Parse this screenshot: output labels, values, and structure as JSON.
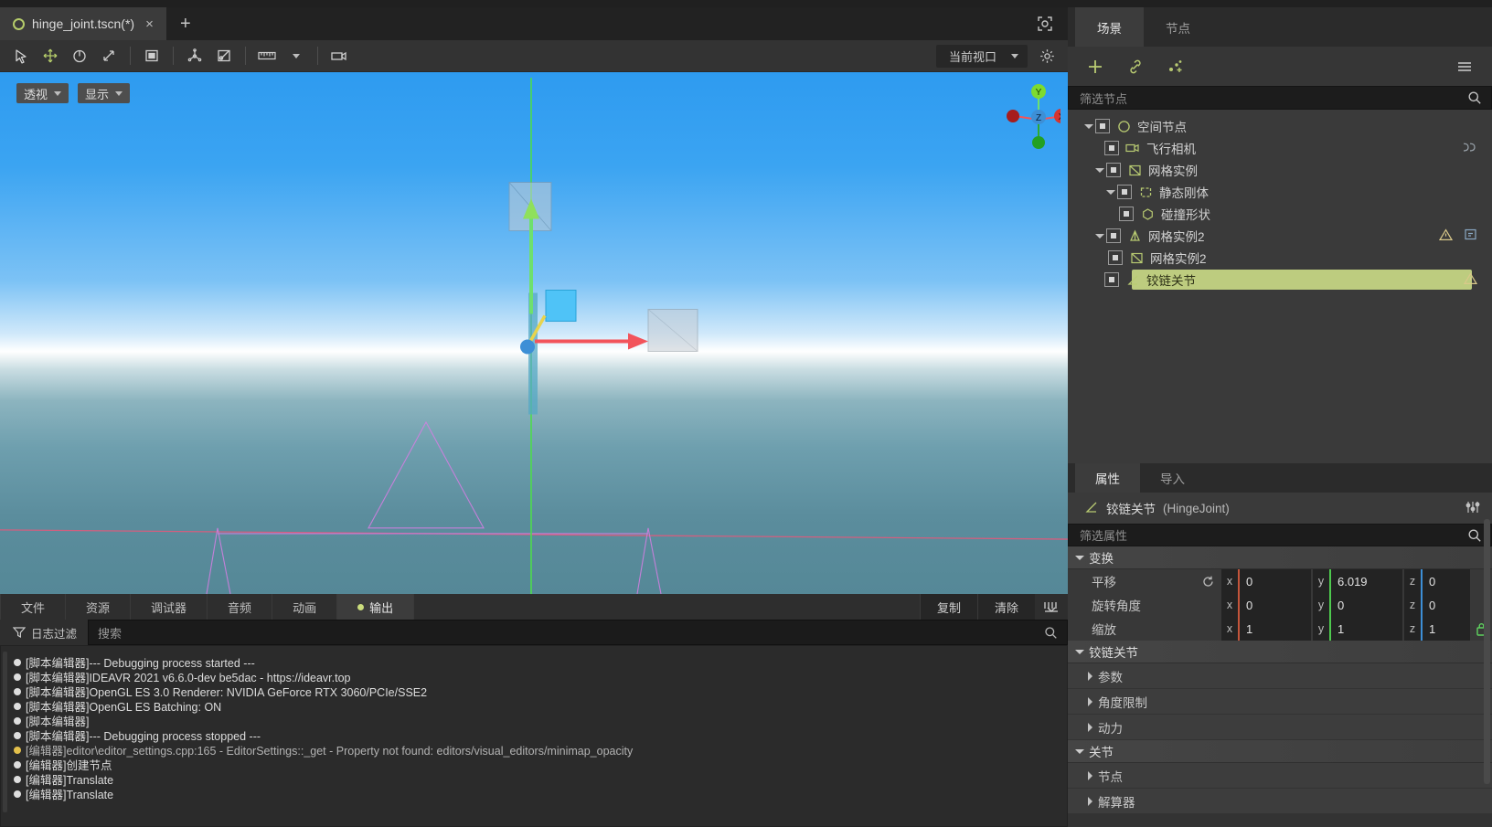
{
  "window": {
    "title": "hinge_joint.tscn(*)"
  },
  "tabbar": {
    "scene_tab_label": "hinge_joint.tscn(*)",
    "close_label": "×",
    "new_tab_label": "+",
    "distraction_free_icon": "expand-icon"
  },
  "toolbar": {
    "tools": [
      {
        "name": "select-mode",
        "icon": "cursor-arrow-icon",
        "selected": false
      },
      {
        "name": "move-mode",
        "icon": "move-arrows-icon",
        "selected": false
      },
      {
        "name": "rotate-mode",
        "icon": "rotate-icon",
        "selected": false
      },
      {
        "name": "scale-mode",
        "icon": "scale-icon",
        "selected": false
      },
      {
        "name": "list-select-mode",
        "icon": "box-select-icon",
        "selected": false
      },
      {
        "name": "local-space-mode",
        "icon": "axis-icon",
        "selected": false
      },
      {
        "name": "snap-mode",
        "icon": "snap-icon",
        "selected": false
      },
      {
        "name": "ruler-mode",
        "icon": "ruler-icon",
        "selected": false
      },
      {
        "name": "camera-preview",
        "icon": "camera-icon",
        "selected": false
      }
    ],
    "viewport_select_label": "当前视口",
    "settings_icon": "gear-icon"
  },
  "viewport": {
    "perspective_label": "透视",
    "display_label": "显示",
    "gizmo_axes": [
      "Y",
      "Z",
      "X"
    ]
  },
  "bottom_dock": {
    "tabs": [
      {
        "label": "文件",
        "active": false,
        "dot": false
      },
      {
        "label": "资源",
        "active": false,
        "dot": false
      },
      {
        "label": "调试器",
        "active": false,
        "dot": false
      },
      {
        "label": "音频",
        "active": false,
        "dot": false
      },
      {
        "label": "动画",
        "active": false,
        "dot": false
      },
      {
        "label": "输出",
        "active": true,
        "dot": true
      }
    ],
    "copy_label": "复制",
    "clear_label": "清除",
    "collapse_icon": "collapse-down-icon",
    "log_filter_label": "日志过滤",
    "search_placeholder": "搜索",
    "search_icon": "search-icon",
    "log_lines": [
      {
        "level": "info",
        "text": "[脚本编辑器]--- Debugging process started ---"
      },
      {
        "level": "info",
        "text": "[脚本编辑器]IDEAVR 2021 v6.6.0-dev be5dac - https://ideavr.top"
      },
      {
        "level": "info",
        "text": "[脚本编辑器]OpenGL ES 3.0 Renderer: NVIDIA GeForce RTX 3060/PCIe/SSE2"
      },
      {
        "level": "info",
        "text": "[脚本编辑器]OpenGL ES Batching: ON"
      },
      {
        "level": "info",
        "text": "[脚本编辑器]"
      },
      {
        "level": "info",
        "text": "[脚本编辑器]--- Debugging process stopped ---"
      },
      {
        "level": "warn",
        "text": "[编辑器]editor\\editor_settings.cpp:165 - EditorSettings::_get - Property not found: editors/visual_editors/minimap_opacity"
      },
      {
        "level": "info",
        "text": "[编辑器]创建节点"
      },
      {
        "level": "info",
        "text": "[编辑器]Translate"
      },
      {
        "level": "info",
        "text": "[编辑器]Translate"
      }
    ]
  },
  "scene_panel": {
    "tabs": [
      {
        "label": "场景",
        "active": true
      },
      {
        "label": "节点",
        "active": false
      }
    ],
    "tools": [
      {
        "name": "add-node-button",
        "icon": "plus-icon"
      },
      {
        "name": "instance-scene-button",
        "icon": "link-icon"
      },
      {
        "name": "attach-script-button",
        "icon": "script-graph-icon"
      }
    ],
    "menu_icon": "hamburger-icon",
    "filter_placeholder": "筛选节点",
    "search_icon": "search-icon",
    "tree": [
      {
        "label": "空间节点",
        "depth": 0,
        "twist": "open",
        "icon": "spatial-node-icon",
        "selected": false,
        "badges": []
      },
      {
        "label": "飞行相机",
        "depth": 1,
        "twist": "none",
        "icon": "camera-node-icon",
        "selected": false,
        "badges": [
          "script-icon"
        ]
      },
      {
        "label": "网格实例",
        "depth": 1,
        "twist": "open",
        "icon": "mesh-instance-icon",
        "selected": false,
        "badges": []
      },
      {
        "label": "静态刚体",
        "depth": 2,
        "twist": "open",
        "icon": "static-body-icon",
        "selected": false,
        "badges": []
      },
      {
        "label": "碰撞形状",
        "depth": 3,
        "twist": "none",
        "icon": "collision-shape-icon",
        "selected": false,
        "badges": []
      },
      {
        "label": "网格实例2",
        "depth": 1,
        "twist": "open",
        "icon": "rigid-body-icon",
        "selected": false,
        "badges": [
          "warning-icon",
          "remote-icon"
        ]
      },
      {
        "label": "网格实例2",
        "depth": 2,
        "twist": "none",
        "icon": "mesh-instance-icon",
        "selected": false,
        "badges": []
      },
      {
        "label": "铰链关节",
        "depth": 2,
        "twist": "none",
        "icon": "hinge-joint-icon",
        "selected": true,
        "badges": [
          "warning-icon"
        ]
      }
    ]
  },
  "inspector": {
    "tabs": [
      {
        "label": "属性",
        "active": true
      },
      {
        "label": "导入",
        "active": false
      }
    ],
    "node_icon": "hinge-joint-icon",
    "node_name": "铰链关节",
    "node_class": "(HingeJoint)",
    "header_tools": [
      "toggle-visibility-icon",
      "object-menu-icon"
    ],
    "filter_placeholder": "筛选属性",
    "search_icon": "search-icon",
    "groups": [
      {
        "label": "变换",
        "expanded": true,
        "properties": [
          {
            "label": "平移",
            "reset_icon": "revert-icon",
            "fields": [
              {
                "axis": "x",
                "value": "0",
                "color": "#c4553b"
              },
              {
                "axis": "y",
                "value": "6.019",
                "color": "#4ec94e"
              },
              {
                "axis": "z",
                "value": "0",
                "color": "#3d8fd6"
              }
            ],
            "lock": false
          },
          {
            "label": "旋转角度",
            "reset_icon": "",
            "fields": [
              {
                "axis": "x",
                "value": "0",
                "color": "#c4553b"
              },
              {
                "axis": "y",
                "value": "0",
                "color": "#4ec94e"
              },
              {
                "axis": "z",
                "value": "0",
                "color": "#3d8fd6"
              }
            ],
            "lock": false
          },
          {
            "label": "缩放",
            "reset_icon": "",
            "fields": [
              {
                "axis": "x",
                "value": "1",
                "color": "#c4553b"
              },
              {
                "axis": "y",
                "value": "1",
                "color": "#4ec94e"
              },
              {
                "axis": "z",
                "value": "1",
                "color": "#3d8fd6"
              }
            ],
            "lock": true,
            "lock_icon": "link-lock-icon"
          }
        ]
      }
    ],
    "sections": [
      {
        "type": "group",
        "label": "铰链关节",
        "expanded": true
      },
      {
        "type": "sub",
        "label": "参数",
        "expanded": false
      },
      {
        "type": "sub",
        "label": "角度限制",
        "expanded": false
      },
      {
        "type": "sub",
        "label": "动力",
        "expanded": false
      },
      {
        "type": "group",
        "label": "关节",
        "expanded": true
      },
      {
        "type": "sub",
        "label": "节点",
        "expanded": false
      },
      {
        "type": "sub",
        "label": "解算器",
        "expanded": false
      }
    ]
  },
  "colors": {
    "accent_green": "#b9cb72",
    "selection": "#bdcc7f",
    "axis_x": "#c4553b",
    "axis_y": "#4ec94e",
    "axis_z": "#3d8fd6",
    "warning": "#e3c04b"
  }
}
